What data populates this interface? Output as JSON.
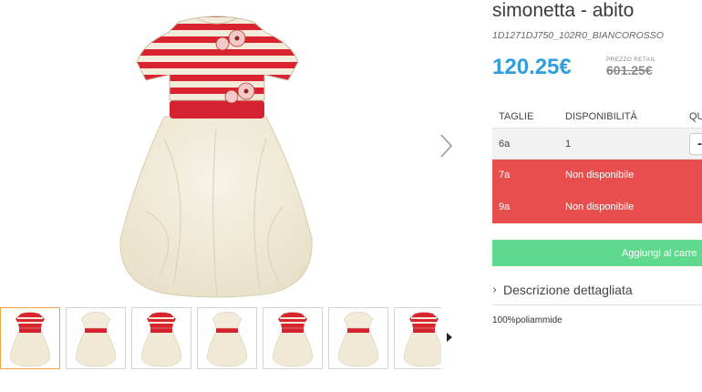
{
  "product": {
    "title": "simonetta - abito",
    "sku": "1D1271DJ750_102R0_BIANCOROSSO",
    "price": "120.25€",
    "retail_label": "PREZZO RETAIL",
    "retail_price": "601.25€"
  },
  "colors": {
    "price": "#2e9fdc",
    "unavailable_row": "#e84e4e",
    "add_to_cart": "#5ed98d",
    "active_thumb_border": "#f0a43b"
  },
  "gallery": {
    "thumbnail_count": 7,
    "active_index": 0
  },
  "sizes": {
    "headers": {
      "size": "TAGLIE",
      "availability": "DISPONIBILITÀ",
      "quantity": "QU"
    },
    "rows": [
      {
        "size": "6a",
        "availability": "1",
        "status": "available",
        "qty_button": "-"
      },
      {
        "size": "7a",
        "availability": "Non disponibile",
        "status": "unavailable"
      },
      {
        "size": "9a",
        "availability": "Non disponibile",
        "status": "unavailable"
      }
    ]
  },
  "actions": {
    "add_to_cart": "Aggiungi al carre"
  },
  "description": {
    "toggle_label": "Descrizione dettagliata",
    "material": "100%poliammide"
  },
  "icons": {
    "next_image": "chevron-right-icon",
    "thumbs_next": "caret-right-icon",
    "description_toggle": "chevron-right-icon"
  }
}
